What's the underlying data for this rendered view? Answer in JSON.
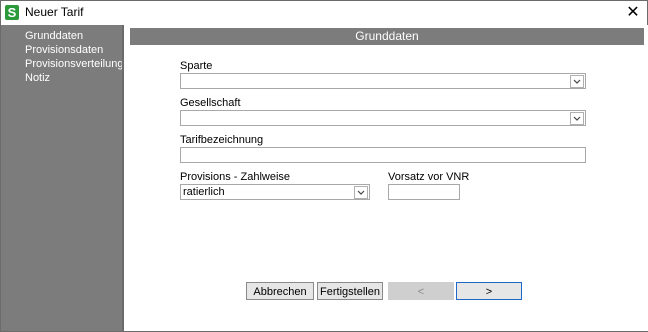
{
  "window": {
    "title": "Neuer Tarif",
    "app_icon_glyph": "S",
    "close_glyph": "✕"
  },
  "sidebar": {
    "items": [
      {
        "label": "Grunddaten"
      },
      {
        "label": "Provisionsdaten"
      },
      {
        "label": "Provisionsverteilung"
      },
      {
        "label": "Notiz"
      }
    ]
  },
  "section": {
    "title": "Grunddaten"
  },
  "form": {
    "sparte": {
      "label": "Sparte",
      "value": ""
    },
    "gesellschaft": {
      "label": "Gesellschaft",
      "value": ""
    },
    "tarifbezeichnung": {
      "label": "Tarifbezeichnung",
      "value": ""
    },
    "zahlweise": {
      "label": "Provisions - Zahlweise",
      "value": "ratierlich"
    },
    "vorsatz": {
      "label": "Vorsatz vor VNR",
      "value": ""
    }
  },
  "buttons": {
    "cancel": "Abbrechen",
    "finish": "Fertigstellen",
    "back": "<",
    "next": ">"
  },
  "colors": {
    "sidebar_bg": "#7c7c7c",
    "header_bg": "#7c7c7c",
    "accent_border": "#1e68c9",
    "app_icon": "#2a9a3a"
  }
}
